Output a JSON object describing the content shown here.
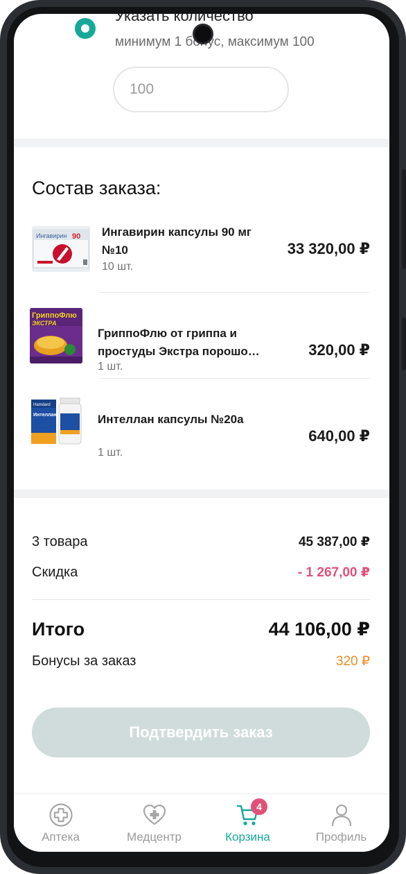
{
  "bonus": {
    "title": "Указать количество",
    "hint": "минимум 1 бонус, максимум 100",
    "input_placeholder": "100"
  },
  "order": {
    "title": "Состав заказа:",
    "items": [
      {
        "name_line1": "Ингавирин капсулы 90 мг",
        "name_line2": "№10",
        "qty": "10 шт.",
        "price": "33 320,00 ₽"
      },
      {
        "name_line1": "ГриппоФлю от гриппа и",
        "name_line2": "простуды Экстра порошо…",
        "qty": "1 шт.",
        "price": "320,00 ₽"
      },
      {
        "name_line1": "Интеллан капсулы №20а",
        "name_line2": "",
        "qty": "1 шт.",
        "price": "640,00 ₽"
      }
    ]
  },
  "summary": {
    "items_label": "3 товара",
    "items_value": "45 387,00 ₽",
    "discount_label": "Скидка",
    "discount_value": "- 1 267,00 ₽",
    "total_label": "Итого",
    "total_value": "44 106,00 ₽",
    "bonus_label": "Бонусы за заказ",
    "bonus_value": "320 ₽"
  },
  "confirm_label": "Подтвердить заказ",
  "tabbar": {
    "tabs": [
      {
        "label": "Аптека",
        "icon": "pharmacy-cross-icon"
      },
      {
        "label": "Медцентр",
        "icon": "medcenter-heart-icon"
      },
      {
        "label": "Корзина",
        "icon": "cart-icon",
        "badge": "4",
        "active": true
      },
      {
        "label": "Профиль",
        "icon": "profile-icon"
      }
    ]
  },
  "colors": {
    "accent": "#16a99a",
    "discount": "#e0517a",
    "bonus": "#f08a24",
    "button_disabled": "#cfdcdb",
    "badge": "#e0517a"
  }
}
